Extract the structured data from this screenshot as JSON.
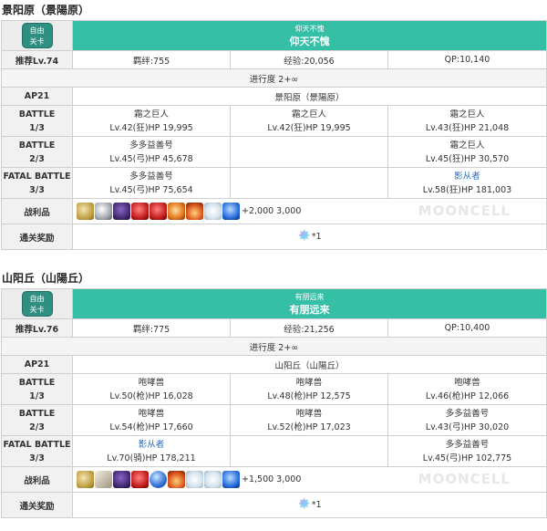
{
  "quests": [
    {
      "section_title": "景阳原（景陽原）",
      "badge_text": "自由\n关卡",
      "quest_name_small": "仰天不愧",
      "quest_name": "仰天不愧",
      "recommend": "推荐Lv.74",
      "bond": "羁绊:755",
      "exp": "经验:20,056",
      "qp": "QP:10,140",
      "progress": "进行度 2+∞",
      "ap": "AP21",
      "location": "景阳原（景陽原）",
      "battles": [
        {
          "label1": "BATTLE",
          "label2": "1/3",
          "enemies": [
            {
              "name": "霜之巨人",
              "stats": "Lv.42(狂)HP 19,995"
            },
            {
              "name": "霜之巨人",
              "stats": "Lv.42(狂)HP 19,995"
            },
            {
              "name": "霜之巨人",
              "stats": "Lv.43(狂)HP 21,048"
            }
          ]
        },
        {
          "label1": "BATTLE",
          "label2": "2/3",
          "enemies": [
            {
              "name": "多多益善号",
              "stats": "Lv.45(弓)HP 45,678"
            },
            {
              "name": "",
              "stats": ""
            },
            {
              "name": "霜之巨人",
              "stats": "Lv.45(狂)HP 30,570"
            }
          ]
        },
        {
          "label1": "FATAL BATTLE",
          "label2": "3/3",
          "enemies": [
            {
              "name": "多多益善号",
              "stats": "Lv.45(弓)HP 75,654"
            },
            {
              "name": "",
              "stats": ""
            },
            {
              "name": "影从者",
              "stats": "Lv.58(狂)HP 181,003",
              "servant": true
            }
          ]
        }
      ],
      "drops_label": "战利品",
      "drops": [
        "gold-gear",
        "silver-gear",
        "dark-crystal",
        "red-gem",
        "red-gem",
        "orange-ember",
        "ember",
        "white-crystal",
        "blue-gem"
      ],
      "drops_text": "+2,000 3,000",
      "clear_label": "通关奖励",
      "clear_reward": "*1"
    },
    {
      "section_title": "山阳丘（山陽丘）",
      "badge_text": "自由\n关卡",
      "quest_name_small": "有朋远来",
      "quest_name": "有朋远来",
      "recommend": "推荐Lv.76",
      "bond": "羁绊:775",
      "exp": "经验:21,256",
      "qp": "QP:10,400",
      "progress": "进行度 2+∞",
      "ap": "AP21",
      "location": "山阳丘（山陽丘）",
      "battles": [
        {
          "label1": "BATTLE",
          "label2": "1/3",
          "enemies": [
            {
              "name": "咆哮兽",
              "stats": "Lv.50(枪)HP 16,028"
            },
            {
              "name": "咆哮兽",
              "stats": "Lv.48(枪)HP 12,575"
            },
            {
              "name": "咆哮兽",
              "stats": "Lv.46(枪)HP 12,066"
            }
          ]
        },
        {
          "label1": "BATTLE",
          "label2": "2/3",
          "enemies": [
            {
              "name": "咆哮兽",
              "stats": "Lv.54(枪)HP 17,660"
            },
            {
              "name": "咆哮兽",
              "stats": "Lv.52(枪)HP 17,023"
            },
            {
              "name": "多多益善号",
              "stats": "Lv.43(弓)HP 30,020"
            }
          ]
        },
        {
          "label1": "FATAL BATTLE",
          "label2": "3/3",
          "enemies": [
            {
              "name": "影从者",
              "stats": "Lv.70(骑)HP 178,211",
              "servant": true
            },
            {
              "name": "",
              "stats": ""
            },
            {
              "name": "多多益善号",
              "stats": "Lv.45(弓)HP 102,775"
            }
          ]
        }
      ],
      "drops_label": "战利品",
      "drops": [
        "gold-gear",
        "fang",
        "dark-crystal",
        "red-gem",
        "sphere",
        "ember",
        "white-crystal",
        "white-crystal",
        "blue-gem"
      ],
      "drops_text": "+1,500 3,000",
      "clear_label": "通关奖励",
      "clear_reward": "*1"
    }
  ],
  "watermark": "MOONCELL"
}
